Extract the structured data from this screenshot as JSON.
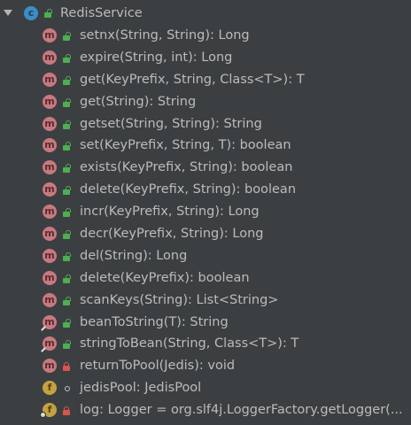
{
  "tree": {
    "root": {
      "label": "RedisService",
      "icon": "class-icon",
      "visibility": "public"
    },
    "members": [
      {
        "label": "setnx(String, String): Long",
        "kind": "method",
        "visibility": "public",
        "modifier": ""
      },
      {
        "label": "expire(String, int): Long",
        "kind": "method",
        "visibility": "public",
        "modifier": ""
      },
      {
        "label": "get(KeyPrefix, String, Class<T>): T",
        "kind": "method",
        "visibility": "public",
        "modifier": ""
      },
      {
        "label": "get(String): String",
        "kind": "method",
        "visibility": "public",
        "modifier": ""
      },
      {
        "label": "getset(String, String): String",
        "kind": "method",
        "visibility": "public",
        "modifier": ""
      },
      {
        "label": "set(KeyPrefix, String, T): boolean",
        "kind": "method",
        "visibility": "public",
        "modifier": ""
      },
      {
        "label": "exists(KeyPrefix, String): boolean",
        "kind": "method",
        "visibility": "public",
        "modifier": ""
      },
      {
        "label": "delete(KeyPrefix, String): boolean",
        "kind": "method",
        "visibility": "public",
        "modifier": ""
      },
      {
        "label": "incr(KeyPrefix, String): Long",
        "kind": "method",
        "visibility": "public",
        "modifier": ""
      },
      {
        "label": "decr(KeyPrefix, String): Long",
        "kind": "method",
        "visibility": "public",
        "modifier": ""
      },
      {
        "label": "del(String): Long",
        "kind": "method",
        "visibility": "public",
        "modifier": ""
      },
      {
        "label": "delete(KeyPrefix): boolean",
        "kind": "method",
        "visibility": "public",
        "modifier": ""
      },
      {
        "label": "scanKeys(String): List<String>",
        "kind": "method",
        "visibility": "public",
        "modifier": ""
      },
      {
        "label": "beanToString(T): String",
        "kind": "method",
        "visibility": "public",
        "modifier": "static"
      },
      {
        "label": "stringToBean(String, Class<T>): T",
        "kind": "method",
        "visibility": "public",
        "modifier": "static"
      },
      {
        "label": "returnToPool(Jedis): void",
        "kind": "method",
        "visibility": "private",
        "modifier": ""
      },
      {
        "label": "jedisPool: JedisPool",
        "kind": "field",
        "visibility": "package",
        "modifier": ""
      },
      {
        "label": "log: Logger = org.slf4j.LoggerFactory.getLogger(...",
        "kind": "field",
        "visibility": "private",
        "modifier": "static"
      }
    ]
  },
  "badges": {
    "class": "c",
    "method": "m",
    "field": "f"
  },
  "colors": {
    "background": "#3c3f41",
    "text": "#bbbbbb",
    "class_badge": "#3b8ec4",
    "method_badge": "#c67a7f",
    "field_badge": "#c4a142",
    "public_lock": "#4caf50",
    "private_lock": "#d9534f"
  }
}
